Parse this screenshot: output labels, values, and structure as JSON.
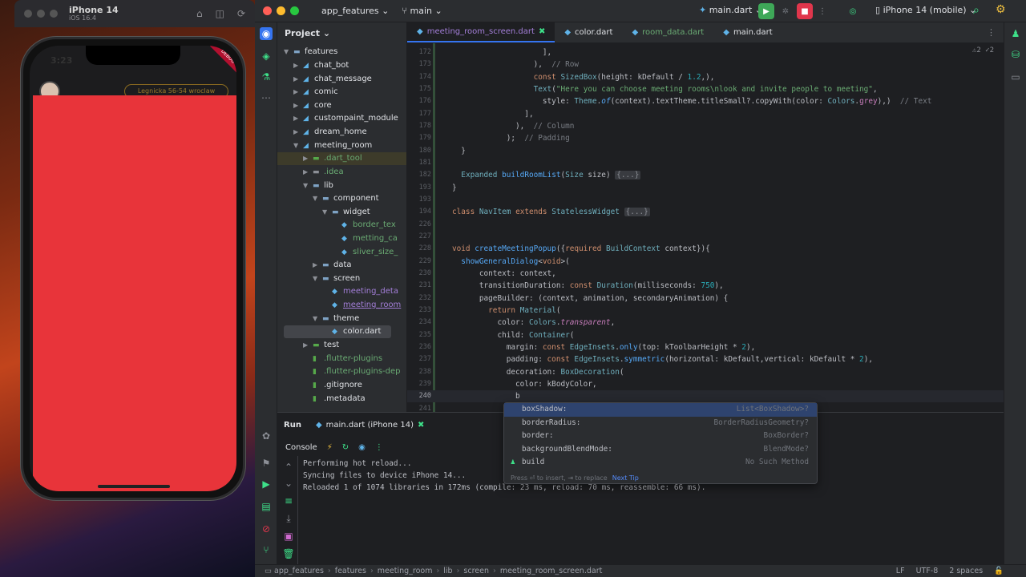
{
  "simulator": {
    "title": "iPhone 14",
    "subtitle": "iOS 16.4",
    "status_time": "3:23",
    "debug_banner": "DEBUG",
    "location_chip": "Legnicka 56-54 wroclaw",
    "overlay_color": "#e8343a"
  },
  "toolbar": {
    "project": "app_features",
    "branch": "main",
    "run_config": "main.dart",
    "device": "iPhone 14 (mobile)"
  },
  "project_panel": {
    "title": "Project",
    "items": [
      {
        "label": "features"
      },
      {
        "label": "chat_bot"
      },
      {
        "label": "chat_message"
      },
      {
        "label": "comic"
      },
      {
        "label": "core"
      },
      {
        "label": "custompaint_module"
      },
      {
        "label": "dream_home"
      },
      {
        "label": "meeting_room"
      },
      {
        "label": ".dart_tool"
      },
      {
        "label": ".idea"
      },
      {
        "label": "lib"
      },
      {
        "label": "component"
      },
      {
        "label": "widget"
      },
      {
        "label": "border_tex"
      },
      {
        "label": "metting_ca"
      },
      {
        "label": "sliver_size_"
      },
      {
        "label": "data"
      },
      {
        "label": "screen"
      },
      {
        "label": "meeting_deta"
      },
      {
        "label": "meeting_room"
      },
      {
        "label": "theme"
      },
      {
        "label": "color.dart"
      },
      {
        "label": "test"
      },
      {
        "label": ".flutter-plugins"
      },
      {
        "label": ".flutter-plugins-dep"
      },
      {
        "label": ".gitignore"
      },
      {
        "label": ".metadata"
      }
    ]
  },
  "editor": {
    "tabs": [
      {
        "label": "meeting_room_screen.dart"
      },
      {
        "label": "color.dart"
      },
      {
        "label": "room_data.dart"
      },
      {
        "label": "main.dart"
      }
    ],
    "warnings": "⚠2  ✓2",
    "line_numbers": [
      "172",
      "173",
      "174",
      "175",
      "176",
      "177",
      "178",
      "179",
      "180",
      "181",
      "182",
      "193",
      "194",
      "226",
      "227",
      "228",
      "229",
      "230",
      "231",
      "232",
      "233",
      "234",
      "235",
      "236",
      "237",
      "238",
      "239",
      "240",
      "241"
    ]
  },
  "completion": {
    "items": [
      {
        "name": "boxShadow:",
        "type": "List<BoxShadow>?"
      },
      {
        "name": "borderRadius:",
        "type": "BorderRadiusGeometry?"
      },
      {
        "name": "border:",
        "type": "BoxBorder?"
      },
      {
        "name": "backgroundBlendMode:",
        "type": "BlendMode?"
      },
      {
        "name": "build",
        "type": "No Such Method"
      }
    ],
    "footer": "Press ⏎ to insert, ⇥ to replace",
    "next_tip": "Next Tip"
  },
  "run_panel": {
    "title": "Run",
    "tab": "main.dart (iPhone 14)",
    "console_label": "Console",
    "output": [
      "Performing hot reload...",
      "Syncing files to device iPhone 14...",
      "Reloaded 1 of 1074 libraries in 172ms (compile: 23 ms, reload: 70 ms, reassemble: 66 ms)."
    ]
  },
  "status_bar": {
    "breadcrumbs": [
      "app_features",
      "features",
      "meeting_room",
      "lib",
      "screen",
      "meeting_room_screen.dart"
    ],
    "line_ending": "LF",
    "encoding": "UTF-8",
    "indent": "2 spaces"
  },
  "colors": {
    "accent": "#3574f0",
    "run_green": "#3ee089",
    "stop_red": "#e0364c"
  }
}
